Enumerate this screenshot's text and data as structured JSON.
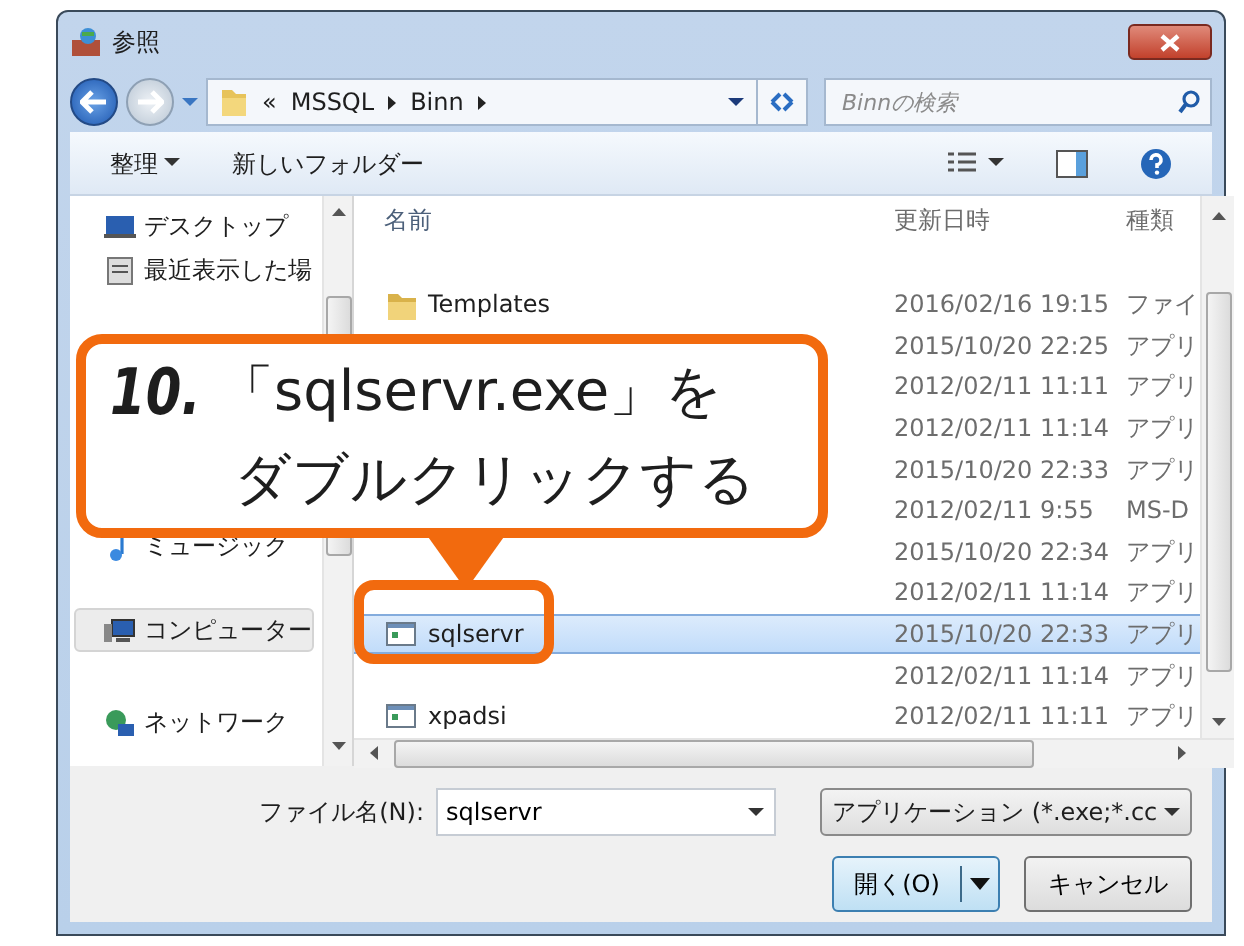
{
  "window": {
    "title": "参照"
  },
  "address": {
    "overflow": "«",
    "segments": [
      "MSSQL",
      "Binn"
    ]
  },
  "search": {
    "placeholder": "Binnの検索"
  },
  "toolbar": [
    {
      "label": "整理",
      "dropdown": true
    },
    {
      "label": "新しいフォルダー",
      "dropdown": false
    }
  ],
  "nav_pane": [
    {
      "label": "デスクトップ",
      "kind": "desktop",
      "selected": false
    },
    {
      "label": "最近表示した場",
      "kind": "recent",
      "selected": false
    },
    {
      "label": "ミュージック",
      "kind": "music",
      "selected": false
    },
    {
      "label": "コンピューター",
      "kind": "computer",
      "selected": true
    },
    {
      "label": "ネットワーク",
      "kind": "network",
      "selected": false
    }
  ],
  "columns": [
    "名前",
    "更新日時",
    "種類"
  ],
  "rows": [
    {
      "name": "Templates",
      "kind": "folder",
      "modified": "2016/02/16 19:15",
      "type": "ファイ",
      "selected": false
    },
    {
      "modified": "2015/10/20 22:25",
      "type": "アプリ",
      "selected": false
    },
    {
      "modified": "2012/02/11 11:11",
      "type": "アプリ",
      "selected": false
    },
    {
      "modified": "2012/02/11 11:14",
      "type": "アプリ",
      "selected": false
    },
    {
      "modified": "2015/10/20 22:33",
      "type": "アプリ",
      "selected": false
    },
    {
      "modified": "2012/02/11 9:55",
      "type": "MS-D",
      "selected": false
    },
    {
      "modified": "2015/10/20 22:34",
      "type": "アプリ",
      "selected": false
    },
    {
      "modified": "2012/02/11 11:14",
      "type": "アプリ",
      "selected": false
    },
    {
      "name": "sqlservr",
      "kind": "app",
      "modified": "2015/10/20 22:33",
      "type": "アプリ",
      "selected": true
    },
    {
      "modified": "2012/02/11 11:14",
      "type": "アプリ",
      "selected": false
    },
    {
      "name": "xpadsi",
      "kind": "app",
      "modified": "2012/02/11 11:11",
      "type": "アプリ",
      "selected": false
    }
  ],
  "file_name": {
    "label": "ファイル名(N):",
    "value": "sqlservr"
  },
  "filter": {
    "value": "アプリケーション (*.exe;*.cc"
  },
  "buttons": [
    {
      "label": "開く(O)",
      "kind": "split",
      "default": true
    },
    {
      "label": "キャンセル",
      "kind": "plain",
      "default": false
    }
  ],
  "callout": {
    "number": "10.",
    "lines": [
      "「sqlservr.exe」を",
      "ダブルクリックする"
    ]
  }
}
